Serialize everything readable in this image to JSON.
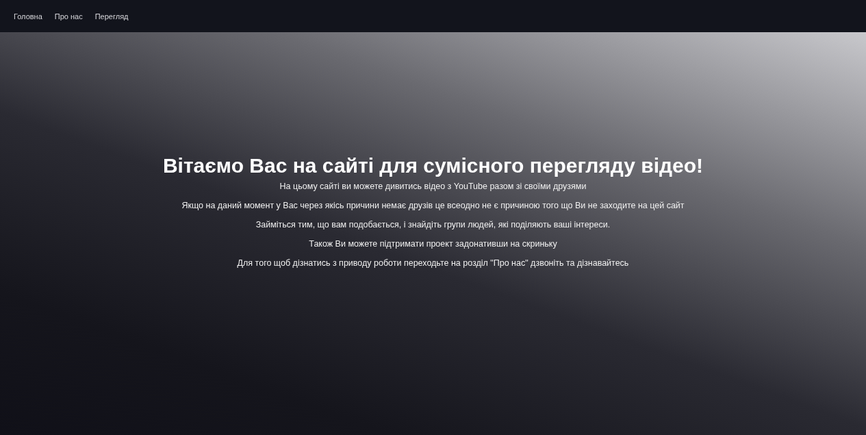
{
  "nav": {
    "links": [
      {
        "label": "Головна"
      },
      {
        "label": "Про нас"
      },
      {
        "label": "Перегляд"
      }
    ]
  },
  "hero": {
    "title": "Вітаємо Вас на сайті для сумісного перегляду відео!",
    "paragraphs": [
      "На цьому сайті ви можете дивитись відео з YouTube разом зі своїми друзями",
      "Якщо на даний момент у Вас через якісь причини немає друзів це всеодно не є причиною того що Ви не заходите на цей сайт",
      "Займіться тим, що вам подобається, і знайдіть групи людей, які поділяють ваші інтереси.",
      "Також Ви можете підтримати проект задонативши на скриньку",
      "Для того щоб дізнатись з приводу роботи переходьте на розділ \"Про нас\" дзвоніть та дізнавайтесь"
    ]
  }
}
